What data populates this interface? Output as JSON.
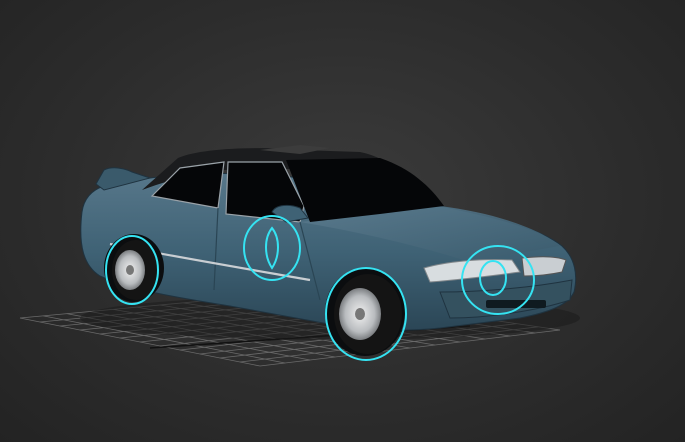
{
  "viewport": {
    "background": "#2c2c2c",
    "grid_color": "#6a6a6a",
    "grid_axis_color": "#111111"
  },
  "model": {
    "paint_color": "#3f6275",
    "glass_color": "#050608",
    "roof_color": "#1b1c1e",
    "trim_color": "#c9ced2",
    "light_color": "#d8dde0"
  },
  "controls": {
    "helper_color": "#35e3f2",
    "helpers": [
      "front-wheel-control-icon",
      "rear-wheel-control-icon",
      "door-control-icon",
      "headlight-control-icon"
    ]
  }
}
